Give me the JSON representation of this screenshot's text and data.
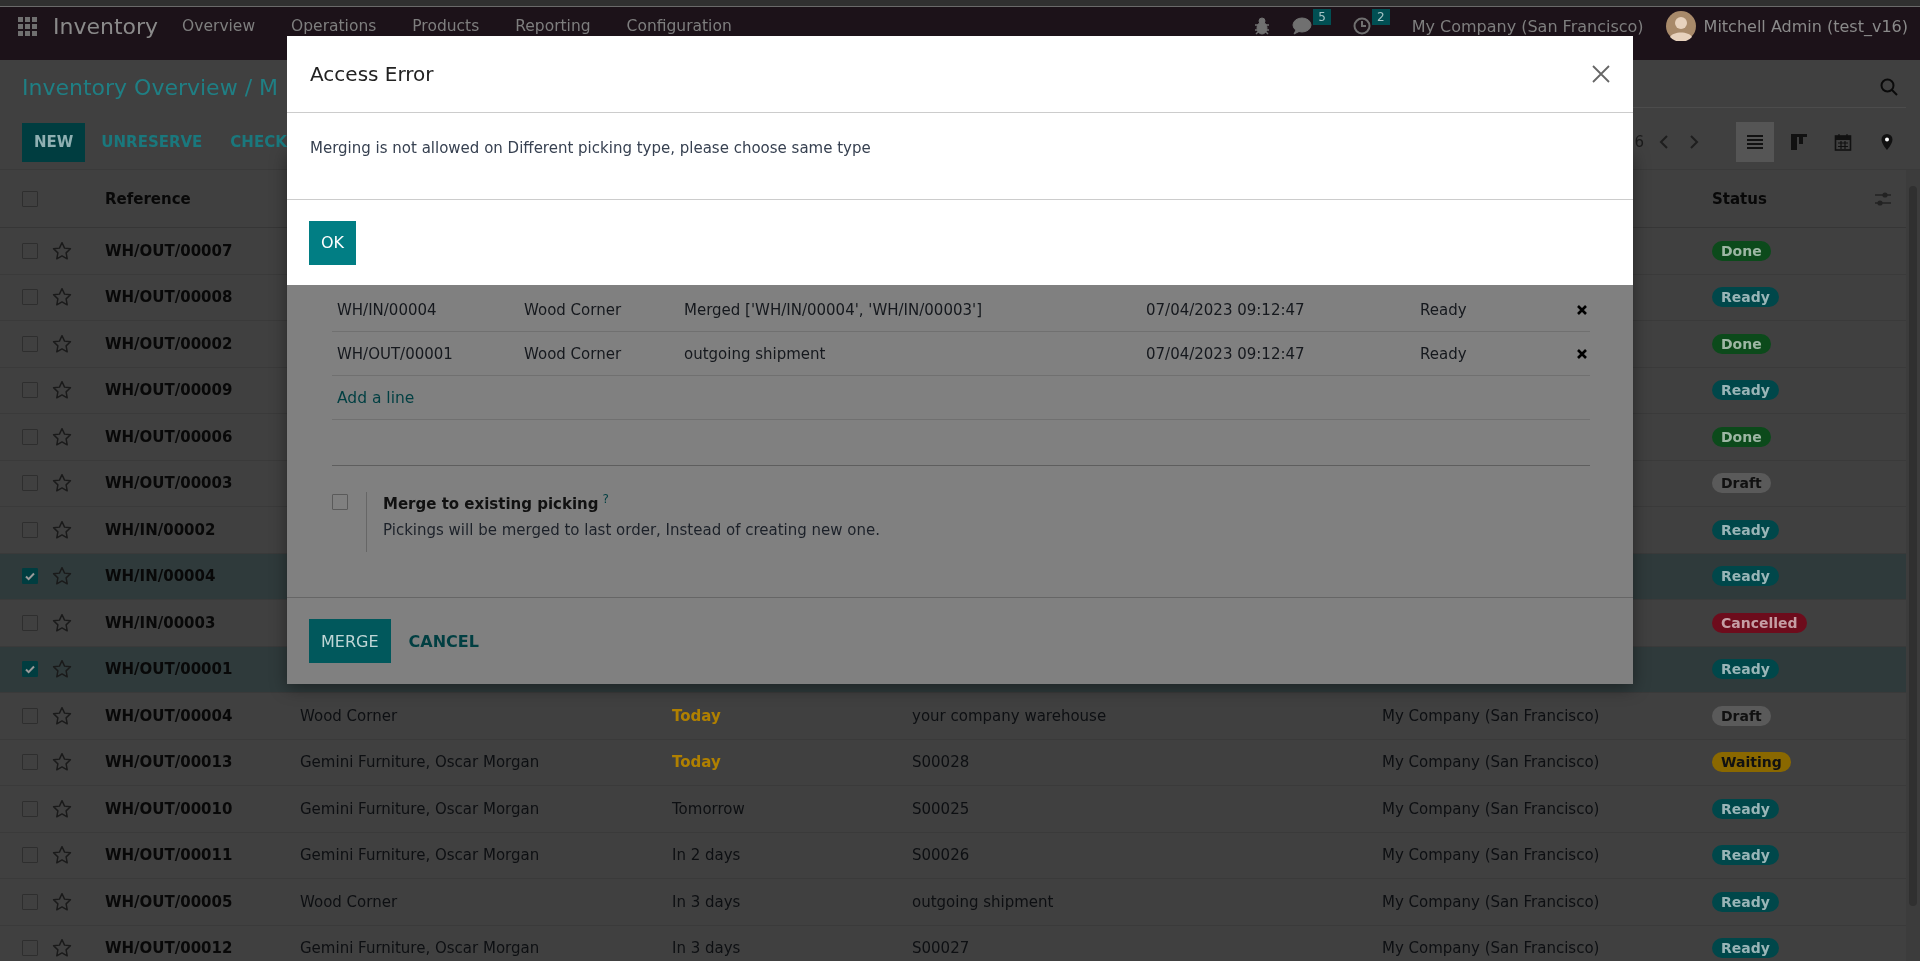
{
  "navbar": {
    "app_name": "Inventory",
    "menu": [
      "Overview",
      "Operations",
      "Products",
      "Reporting",
      "Configuration"
    ],
    "chat_count": "5",
    "activity_count": "2",
    "company": "My Company (San Francisco)",
    "user": "Mitchell Admin (test_v16)"
  },
  "control_panel": {
    "breadcrumb": "Inventory Overview / M",
    "buttons": [
      {
        "label": "NEW",
        "primary": true
      },
      {
        "label": "UNRESERVE",
        "primary": false
      },
      {
        "label": "CHECK",
        "primary": false
      }
    ],
    "pager": "6",
    "views": [
      {
        "kind": "list",
        "selected": true
      },
      {
        "kind": "kanban",
        "selected": false
      },
      {
        "kind": "calendar",
        "selected": false
      },
      {
        "kind": "map",
        "selected": false
      }
    ]
  },
  "list": {
    "header": {
      "reference": "Reference",
      "status": "Status",
      "all_selected": false
    },
    "rows": [
      {
        "reference": "WH/OUT/00007",
        "selected": false,
        "starred": false,
        "status": {
          "label": "Done",
          "color": "#0c4a1b"
        }
      },
      {
        "reference": "WH/OUT/00008",
        "selected": false,
        "starred": false,
        "status": {
          "label": "Ready",
          "color": "#00474a"
        }
      },
      {
        "reference": "WH/OUT/00002",
        "selected": false,
        "starred": false,
        "status": {
          "label": "Done",
          "color": "#0c4a1b"
        }
      },
      {
        "reference": "WH/OUT/00009",
        "selected": false,
        "starred": false,
        "status": {
          "label": "Ready",
          "color": "#00474a"
        }
      },
      {
        "reference": "WH/OUT/00006",
        "selected": false,
        "starred": false,
        "status": {
          "label": "Done",
          "color": "#0c4a1b"
        }
      },
      {
        "reference": "WH/OUT/00003",
        "selected": false,
        "starred": false,
        "status": {
          "label": "Draft",
          "color": "#5a5a5a"
        }
      },
      {
        "reference": "WH/IN/00002",
        "selected": false,
        "starred": false,
        "status": {
          "label": "Ready",
          "color": "#00474a"
        }
      },
      {
        "reference": "WH/IN/00004",
        "selected": true,
        "starred": false,
        "status": {
          "label": "Ready",
          "color": "#00474a"
        }
      },
      {
        "reference": "WH/IN/00003",
        "selected": false,
        "starred": false,
        "status": {
          "label": "Cancelled",
          "color": "#6d0c1c"
        }
      },
      {
        "reference": "WH/OUT/00001",
        "selected": true,
        "starred": false,
        "status": {
          "label": "Ready",
          "color": "#00474a"
        }
      },
      {
        "reference": "WH/OUT/00004",
        "selected": false,
        "starred": false,
        "contact": "Wood Corner",
        "scheduled": "Today",
        "due_today": true,
        "source": "your company warehouse",
        "company": "My Company (San Francisco)",
        "status": {
          "label": "Draft",
          "color": "#5a5a5a"
        }
      },
      {
        "reference": "WH/OUT/00013",
        "selected": false,
        "starred": false,
        "contact": "Gemini Furniture, Oscar Morgan",
        "scheduled": "Today",
        "due_today": true,
        "source": "S00028",
        "company": "My Company (San Francisco)",
        "status": {
          "label": "Waiting",
          "color": "#8a6800"
        }
      },
      {
        "reference": "WH/OUT/00010",
        "selected": false,
        "starred": false,
        "contact": "Gemini Furniture, Oscar Morgan",
        "scheduled": "Tomorrow",
        "due_today": false,
        "source": "S00025",
        "company": "My Company (San Francisco)",
        "status": {
          "label": "Ready",
          "color": "#00474a"
        }
      },
      {
        "reference": "WH/OUT/00011",
        "selected": false,
        "starred": false,
        "contact": "Gemini Furniture, Oscar Morgan",
        "scheduled": "In 2 days",
        "due_today": false,
        "source": "S00026",
        "company": "My Company (San Francisco)",
        "status": {
          "label": "Ready",
          "color": "#00474a"
        }
      },
      {
        "reference": "WH/OUT/00005",
        "selected": false,
        "starred": false,
        "contact": "Wood Corner",
        "scheduled": "In 3 days",
        "due_today": false,
        "source": "outgoing shipment",
        "company": "My Company (San Francisco)",
        "status": {
          "label": "Ready",
          "color": "#00474a"
        }
      },
      {
        "reference": "WH/OUT/00012",
        "selected": false,
        "starred": false,
        "contact": "Gemini Furniture, Oscar Morgan",
        "scheduled": "In 3 days",
        "due_today": false,
        "source": "S00027",
        "company": "My Company (San Francisco)",
        "status": {
          "label": "Ready",
          "color": "#00474a"
        }
      }
    ]
  },
  "merge_dialog": {
    "lines": [
      {
        "reference": "WH/IN/00004",
        "contact": "Wood Corner",
        "description": "Merged ['WH/IN/00004', 'WH/IN/00003']",
        "date": "07/04/2023 09:12:47",
        "status": "Ready"
      },
      {
        "reference": "WH/OUT/00001",
        "contact": "Wood Corner",
        "description": "outgoing shipment",
        "date": "07/04/2023 09:12:47",
        "status": "Ready"
      }
    ],
    "add_line": "Add a line",
    "option": {
      "label": "Merge to existing picking",
      "help_mark": "?",
      "description": "Pickings will be merged to last order, Instead of creating new one.",
      "checked": false
    },
    "buttons": [
      {
        "label": "MERGE",
        "primary": true
      },
      {
        "label": "CANCEL",
        "primary": false
      }
    ]
  },
  "error_dialog": {
    "title": "Access Error",
    "message": "Merging is not allowed on Different picking type, please choose same type",
    "button": "OK"
  }
}
